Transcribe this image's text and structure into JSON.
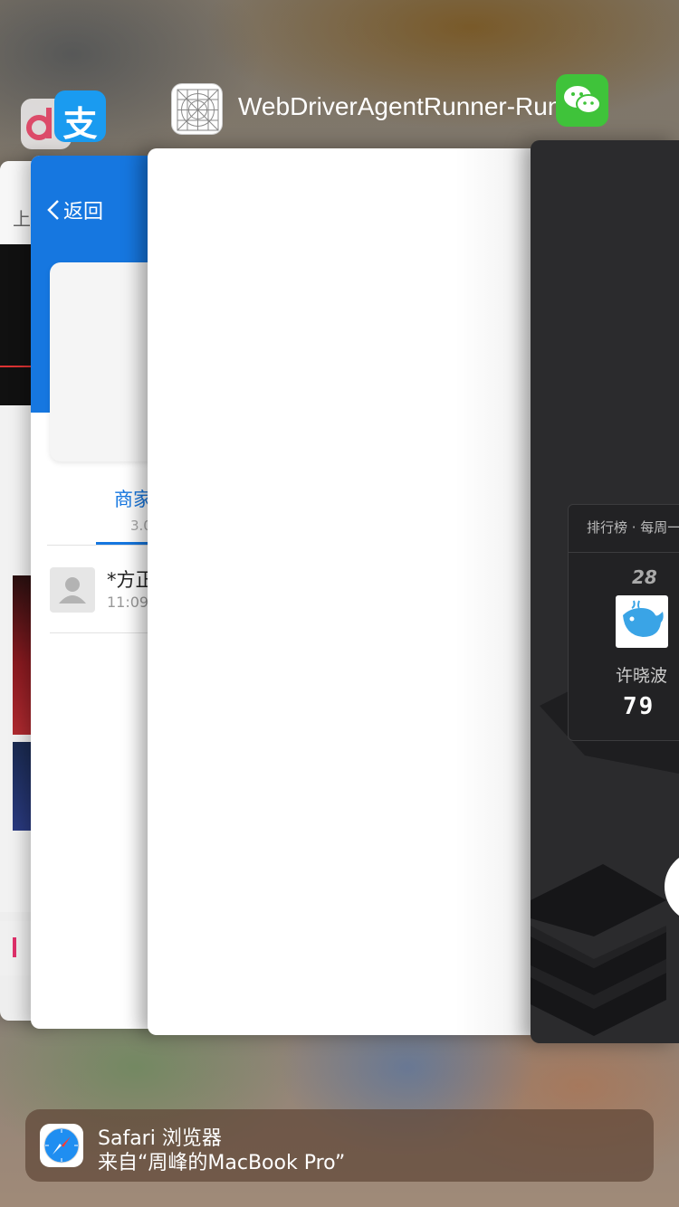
{
  "app_switcher": {
    "focused_app_title": "WebDriverAgentRunner-Runner"
  },
  "cards": {
    "douyu": {
      "top_text": "上",
      "bottom_text": ""
    },
    "alipay": {
      "back_label": "返回",
      "tab_label": "商家",
      "tab_sub": "3.0",
      "contact_name": "*方正",
      "contact_time": "11:09"
    },
    "wechat_game": {
      "panel_title": "排行榜 · 每周一",
      "rank": "28",
      "player_name": "许晓波",
      "score": "79"
    }
  },
  "handoff": {
    "app_name": "Safari 浏览器",
    "source": "来自“周峰的MacBook Pro”"
  },
  "colors": {
    "alipay_blue": "#1677e0",
    "wechat_green": "#3fc33a",
    "handoff_bg": "rgba(95,70,55,0.72)"
  },
  "icons": [
    "douyu-icon",
    "alipay-icon",
    "webdriveragent-icon",
    "wechat-icon",
    "safari-icon"
  ]
}
